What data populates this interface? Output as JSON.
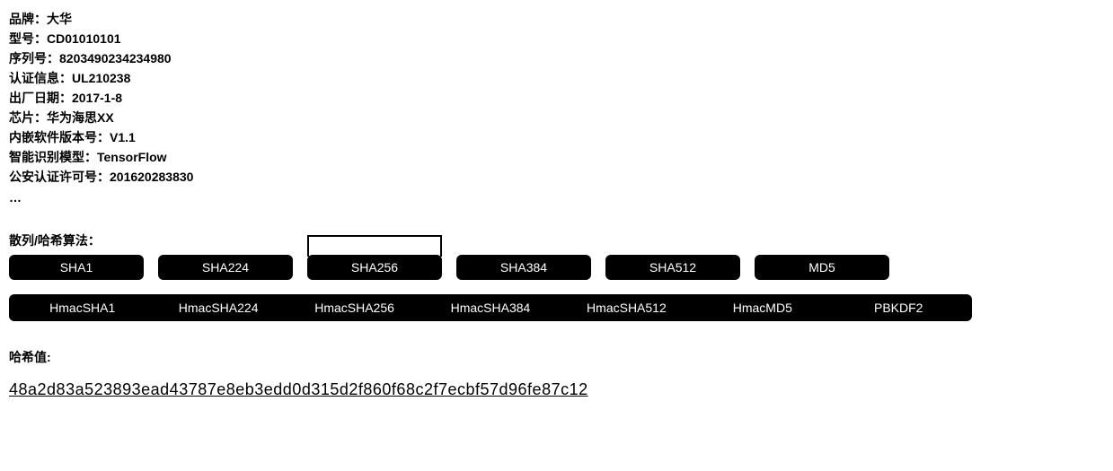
{
  "info": [
    {
      "label": "品牌：",
      "value": "大华"
    },
    {
      "label": "型号：",
      "value": "CD01010101"
    },
    {
      "label": "序列号：",
      "value": "8203490234234980"
    },
    {
      "label": "认证信息：",
      "value": "UL210238"
    },
    {
      "label": "出厂日期：",
      "value": "2017-1-8"
    },
    {
      "label": "芯片：",
      "value": "华为海思XX"
    },
    {
      "label": "内嵌软件版本号：",
      "value": "V1.1"
    },
    {
      "label": "智能识别模型：",
      "value": "TensorFlow"
    },
    {
      "label": "公安认证许可号：",
      "value": "201620283830"
    }
  ],
  "ellipsis": "…",
  "hash_section_label": "散列/哈希算法：",
  "hash_row1": [
    "SHA1",
    "SHA224",
    "SHA256",
    "SHA384",
    "SHA512",
    "MD5"
  ],
  "hash_row1_selected": 2,
  "hash_row2": [
    "HmacSHA1",
    "HmacSHA224",
    "HmacSHA256",
    "HmacSHA384",
    "HmacSHA512",
    "HmacMD5",
    "PBKDF2"
  ],
  "hash_value_label": "哈希值:",
  "hash_value": "48a2d83a523893ead43787e8eb3edd0d315d2f860f68c2f7ecbf57d96fe87c12"
}
